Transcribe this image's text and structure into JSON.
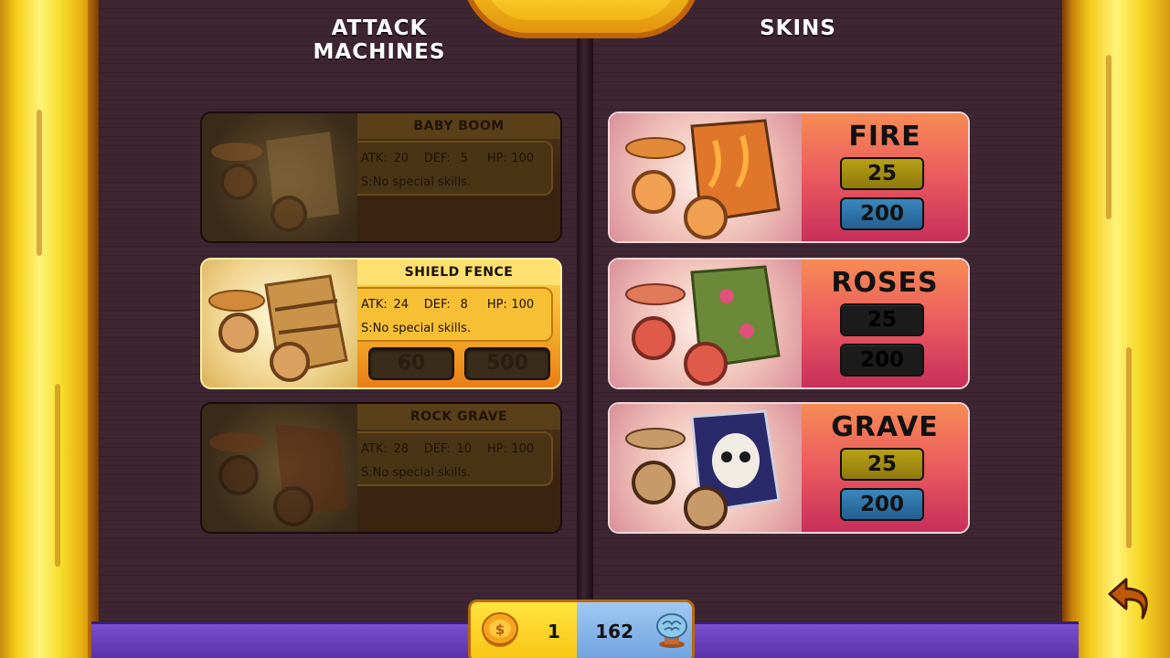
{
  "headers": {
    "left": "ATTACK MACHINES",
    "right": "SKINS"
  },
  "labels": {
    "atk": "ATK:",
    "def": "DEF:",
    "hp": "HP:",
    "skill_prefix": "S:"
  },
  "machines": [
    {
      "name": "BABY BOOM",
      "atk": "20",
      "def": "5",
      "hp": "100",
      "skill": "No special skills.",
      "state": "locked"
    },
    {
      "name": "SHIELD FENCE",
      "atk": "24",
      "def": "8",
      "hp": "100",
      "skill": "No special skills.",
      "state": "selected",
      "price_coins": "60",
      "price_gems": "500"
    },
    {
      "name": "ROCK GRAVE",
      "atk": "28",
      "def": "10",
      "hp": "100",
      "skill": "No special skills.",
      "state": "locked"
    }
  ],
  "skins": [
    {
      "name": "FIRE",
      "price_coins": "25",
      "price_gems": "200",
      "style": "affordable"
    },
    {
      "name": "ROSES",
      "price_coins": "25",
      "price_gems": "200",
      "style": "unavailable"
    },
    {
      "name": "GRAVE",
      "price_coins": "25",
      "price_gems": "200",
      "style": "affordable"
    }
  ],
  "currency": {
    "coins": "1",
    "gems": "162",
    "coin_icon": "coin-icon",
    "gem_icon": "brain-gem-icon"
  },
  "colors": {
    "coin_button": "#a08a12",
    "gem_button": "#2f73a8",
    "skin_panel": "#e0485e",
    "frame_gold": "#f7d21a"
  }
}
